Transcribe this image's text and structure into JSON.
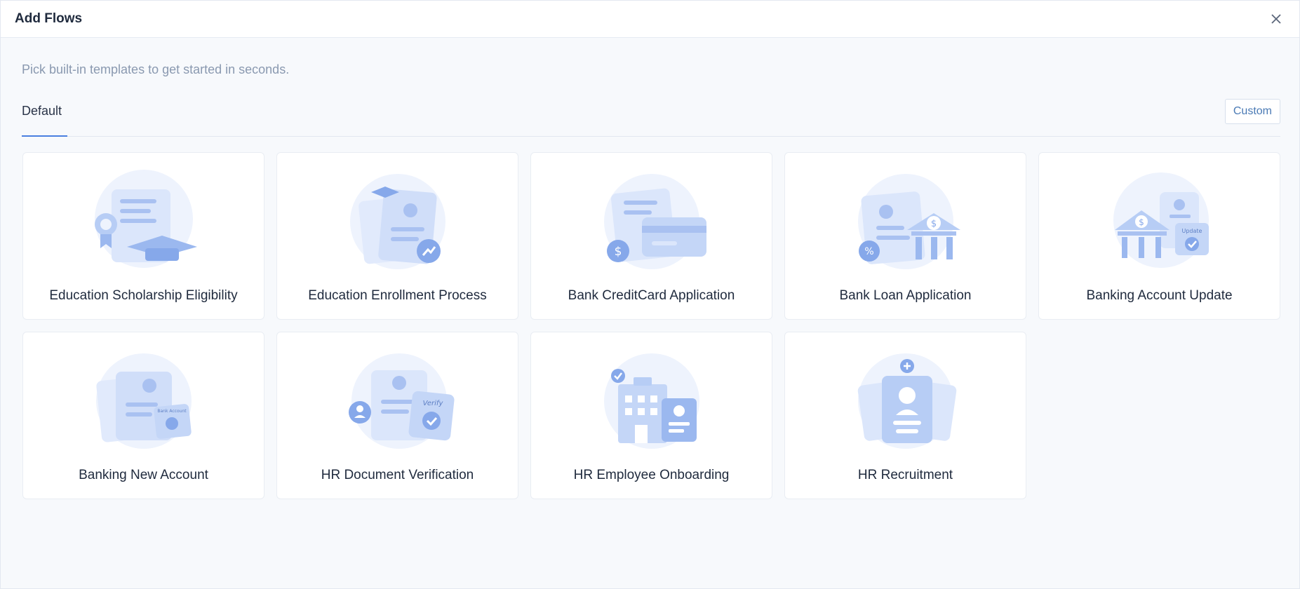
{
  "header": {
    "title": "Add Flows"
  },
  "subtitle": "Pick built-in templates to get started in seconds.",
  "tabs": {
    "default_label": "Default",
    "custom_label": "Custom"
  },
  "templates": [
    {
      "label": "Education Scholarship Eligibility",
      "icon": "scholarship-icon"
    },
    {
      "label": "Education Enrollment Process",
      "icon": "enrollment-icon"
    },
    {
      "label": "Bank CreditCard Application",
      "icon": "credit-card-icon"
    },
    {
      "label": "Bank Loan Application",
      "icon": "bank-loan-icon"
    },
    {
      "label": "Banking Account Update",
      "icon": "account-update-icon",
      "badge": "Update"
    },
    {
      "label": "Banking New Account",
      "icon": "new-account-icon",
      "badge": "Bank Account"
    },
    {
      "label": "HR Document Verification",
      "icon": "document-verification-icon",
      "badge": "Verify"
    },
    {
      "label": "HR Employee Onboarding",
      "icon": "onboarding-icon"
    },
    {
      "label": "HR Recruitment",
      "icon": "recruitment-icon"
    }
  ],
  "colors": {
    "accent": "#4a7fe0",
    "illustration_light": "#e8effc",
    "illustration_mid": "#c9d9f7",
    "illustration_dark": "#9bb8ef"
  }
}
